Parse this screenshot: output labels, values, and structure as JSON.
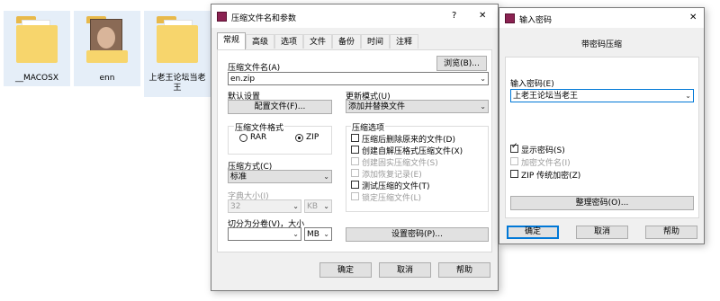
{
  "desktop": {
    "icons": [
      {
        "label": "__MACOSX"
      },
      {
        "label": "enn"
      },
      {
        "label": "上老王论坛当老王"
      }
    ]
  },
  "archive_dialog": {
    "title": "压缩文件名和参数",
    "help_glyph": "?",
    "close_glyph": "✕",
    "tabs": [
      "常规",
      "高级",
      "选项",
      "文件",
      "备份",
      "时间",
      "注释"
    ],
    "active_tab": "常规",
    "archive_name_label": "压缩文件名(A)",
    "browse_button": "浏览(B)...",
    "archive_name_value": "en.zip",
    "default_settings_label": "默认设置",
    "profiles_button": "配置文件(F)...",
    "update_mode_label": "更新模式(U)",
    "update_mode_value": "添加并替换文件",
    "format_group_label": "压缩文件格式",
    "format_rar": "RAR",
    "format_zip": "ZIP",
    "selected_format": "ZIP",
    "method_label": "压缩方式(C)",
    "method_value": "标准",
    "dict_label": "字典大小(I)",
    "dict_value": "32",
    "dict_unit": "KB",
    "split_label": "切分为分卷(V)，大小",
    "split_value": "",
    "split_unit": "MB",
    "options_group_label": "压缩选项",
    "options": [
      {
        "label": "压缩后删除原来的文件(D)",
        "checked": false,
        "enabled": true
      },
      {
        "label": "创建自解压格式压缩文件(X)",
        "checked": false,
        "enabled": true
      },
      {
        "label": "创建固实压缩文件(S)",
        "checked": false,
        "enabled": false
      },
      {
        "label": "添加恢复记录(E)",
        "checked": false,
        "enabled": false
      },
      {
        "label": "测试压缩的文件(T)",
        "checked": false,
        "enabled": true
      },
      {
        "label": "锁定压缩文件(L)",
        "checked": false,
        "enabled": false
      }
    ],
    "set_password_button": "设置密码(P)...",
    "ok_button": "确定",
    "cancel_button": "取消",
    "help_button": "帮助"
  },
  "password_dialog": {
    "title": "输入密码",
    "close_glyph": "✕",
    "subtitle": "带密码压缩",
    "password_label": "输入密码(E)",
    "password_value": "上老王论坛当老王",
    "options": [
      {
        "label": "显示密码(S)",
        "checked": true,
        "enabled": true
      },
      {
        "label": "加密文件名(I)",
        "checked": false,
        "enabled": false
      },
      {
        "label": "ZIP 传统加密(Z)",
        "checked": false,
        "enabled": true
      }
    ],
    "organize_button": "整理密码(O)...",
    "ok_button": "确定",
    "cancel_button": "取消",
    "help_button": "帮助"
  }
}
